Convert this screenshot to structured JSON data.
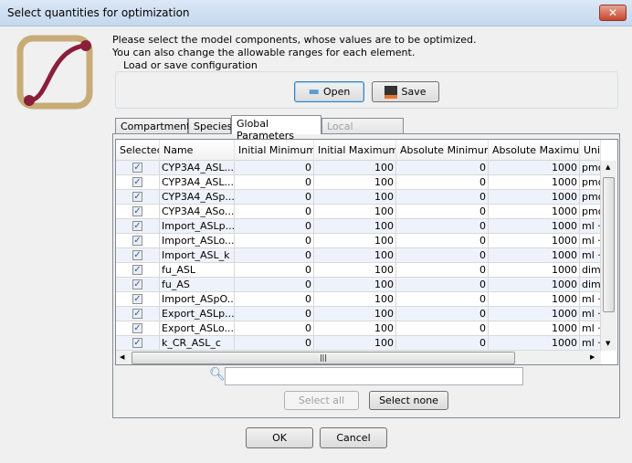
{
  "window": {
    "title": "Select quantities for optimization",
    "close_icon": "close-icon"
  },
  "intro": {
    "line1": "Please select the model components, whose values are to be optimized.",
    "line2": "You can also change the allowable ranges for each element."
  },
  "config": {
    "label": "Load or save configuration",
    "open": "Open",
    "save": "Save"
  },
  "tabs": [
    {
      "label": "Compartments"
    },
    {
      "label": "Species"
    },
    {
      "label": "Global Parameters",
      "active": true
    },
    {
      "label": "Local Parameters",
      "disabled": true
    }
  ],
  "table": {
    "columns": [
      "Selected",
      "Name",
      "Initial Minimum",
      "Initial Maximum",
      "Absolute Minimum",
      "Absolute Maximum",
      "Unit"
    ],
    "rows": [
      {
        "selected": true,
        "name": "CYP3A4_ASL...",
        "init_min": "0",
        "init_max": "100",
        "abs_min": "0",
        "abs_max": "1000",
        "unit": "pmol"
      },
      {
        "selected": true,
        "name": "CYP3A4_ASL...",
        "init_min": "0",
        "init_max": "100",
        "abs_min": "0",
        "abs_max": "1000",
        "unit": "pmol"
      },
      {
        "selected": true,
        "name": "CYP3A4_ASp...",
        "init_min": "0",
        "init_max": "100",
        "abs_min": "0",
        "abs_max": "1000",
        "unit": "pmol"
      },
      {
        "selected": true,
        "name": "CYP3A4_ASo...",
        "init_min": "0",
        "init_max": "100",
        "abs_min": "0",
        "abs_max": "1000",
        "unit": "pmol"
      },
      {
        "selected": true,
        "name": "Import_ASLp...",
        "init_min": "0",
        "init_max": "100",
        "abs_min": "0",
        "abs_max": "1000",
        "unit": "ml · ("
      },
      {
        "selected": true,
        "name": "Import_ASLo...",
        "init_min": "0",
        "init_max": "100",
        "abs_min": "0",
        "abs_max": "1000",
        "unit": "ml · ("
      },
      {
        "selected": true,
        "name": "Import_ASL_k",
        "init_min": "0",
        "init_max": "100",
        "abs_min": "0",
        "abs_max": "1000",
        "unit": "ml · ("
      },
      {
        "selected": true,
        "name": "fu_ASL",
        "init_min": "0",
        "init_max": "100",
        "abs_min": "0",
        "abs_max": "1000",
        "unit": "dimer"
      },
      {
        "selected": true,
        "name": "fu_AS",
        "init_min": "0",
        "init_max": "100",
        "abs_min": "0",
        "abs_max": "1000",
        "unit": "dimer"
      },
      {
        "selected": true,
        "name": "Import_ASpO...",
        "init_min": "0",
        "init_max": "100",
        "abs_min": "0",
        "abs_max": "1000",
        "unit": "ml · ("
      },
      {
        "selected": true,
        "name": "Export_ASLp...",
        "init_min": "0",
        "init_max": "100",
        "abs_min": "0",
        "abs_max": "1000",
        "unit": "ml · ("
      },
      {
        "selected": true,
        "name": "Export_ASLo...",
        "init_min": "0",
        "init_max": "100",
        "abs_min": "0",
        "abs_max": "1000",
        "unit": "ml · ("
      },
      {
        "selected": true,
        "name": "k_CR_ASL_c",
        "init_min": "0",
        "init_max": "100",
        "abs_min": "0",
        "abs_max": "1000",
        "unit": "ml · ("
      }
    ]
  },
  "search": {
    "value": "",
    "placeholder": ""
  },
  "buttons": {
    "select_all": "Select all",
    "select_none": "Select none",
    "ok": "OK",
    "cancel": "Cancel"
  }
}
